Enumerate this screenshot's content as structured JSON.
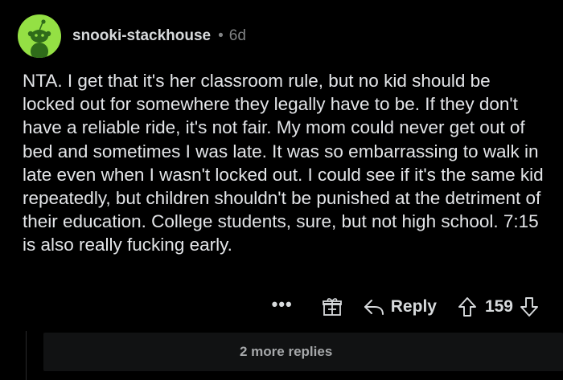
{
  "comment": {
    "author": "snooki-stackhouse",
    "separator": "•",
    "age": "6d",
    "body": "NTA. I get that it's her classroom rule, but no kid should be locked out for somewhere they legally have to be. If they don't have a reliable ride, it's not fair. My mom could never get out of bed and sometimes I was late. It was so embarrassing  to walk in late even when I wasn't locked out. I could see if it's the same kid repeatedly, but children shouldn't be punished at the detriment of their education. College students, sure, but not high school. 7:15 is also really fucking early.",
    "avatar_color": "#94e044"
  },
  "actions": {
    "more_label": "•••",
    "award_icon": "gift-icon",
    "reply_icon": "reply-arrow-icon",
    "reply_label": "Reply",
    "upvote_icon": "upvote-arrow-icon",
    "score": "159",
    "downvote_icon": "downvote-arrow-icon"
  },
  "thread": {
    "more_replies_label": "2 more replies"
  }
}
